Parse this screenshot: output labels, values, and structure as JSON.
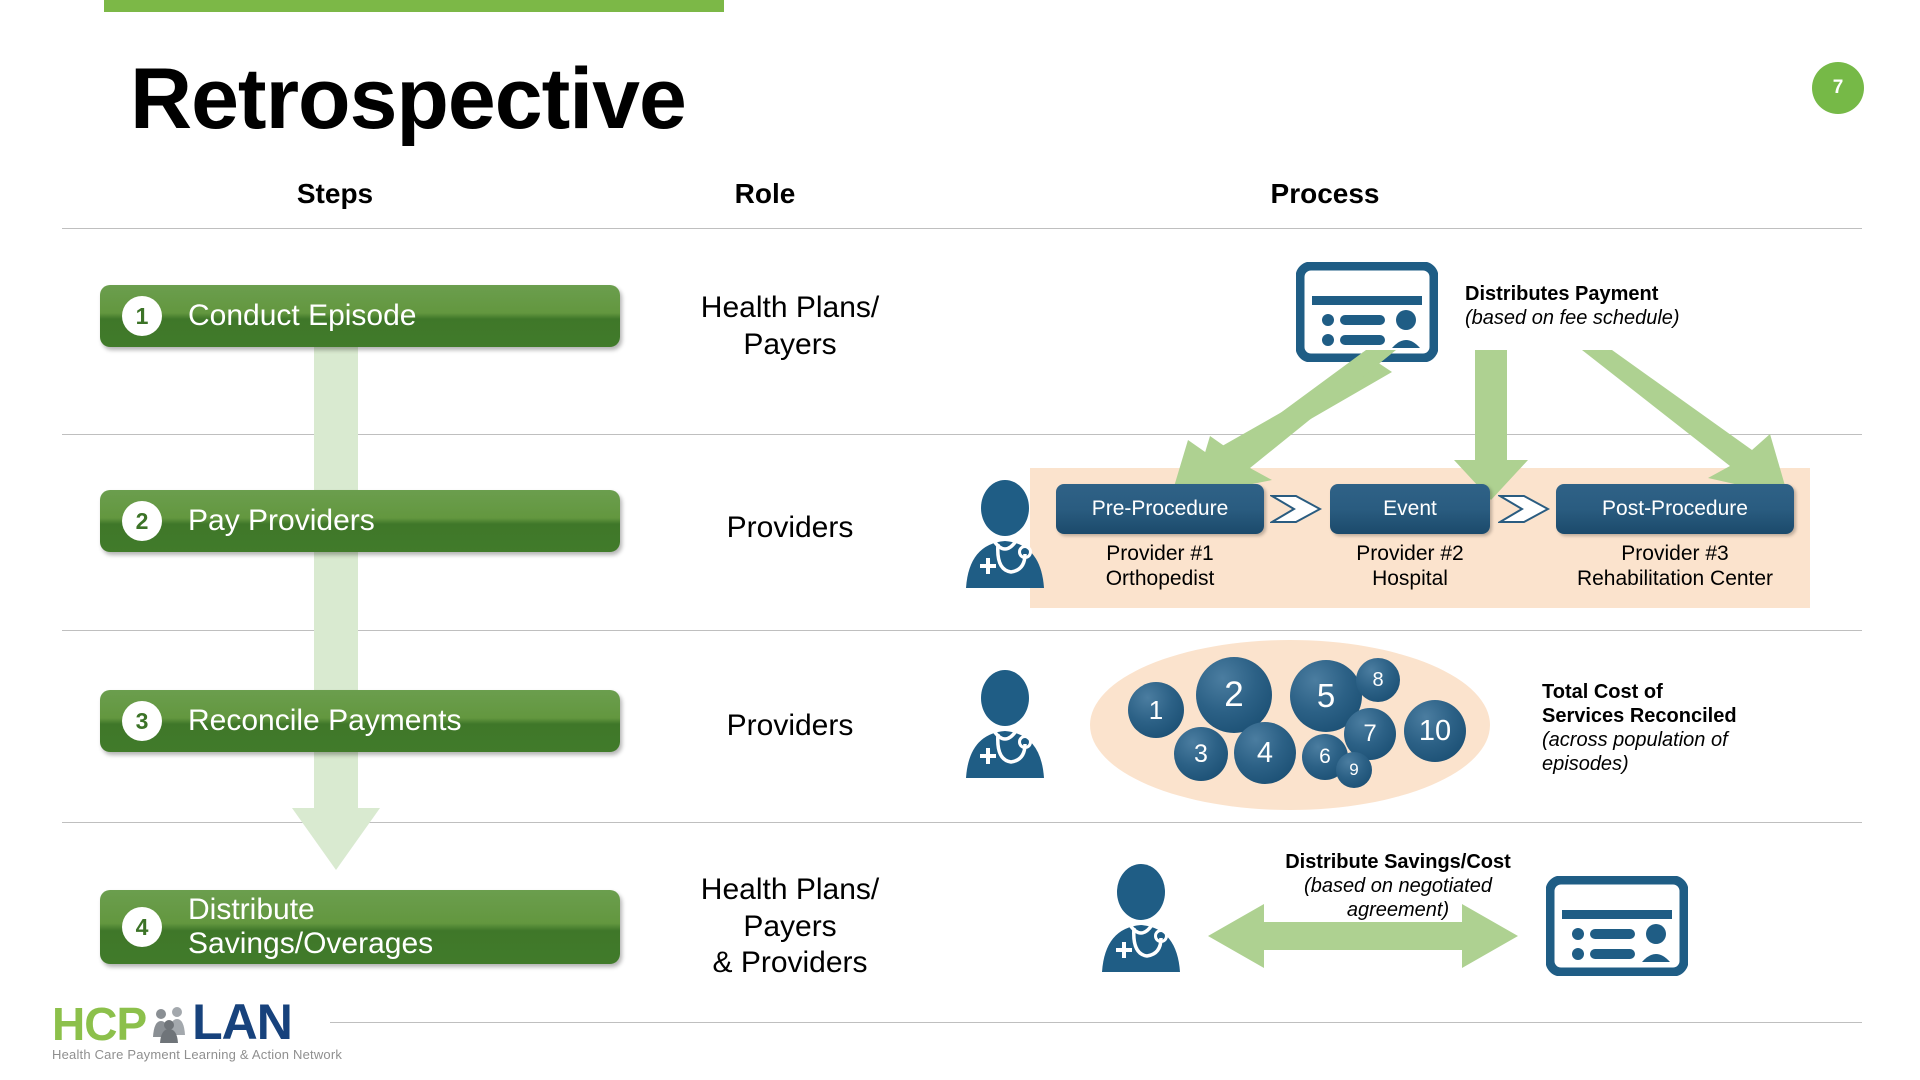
{
  "slide": {
    "title": "Retrospective",
    "page_number": "7",
    "accent_green": "#7cb847",
    "step_green": "#3f7729",
    "process_blue": "#1b4a6b",
    "band_peach": "#fbe3cd",
    "arrow_green_light": "#d9ead0",
    "arrow_green_mid": "#aed191"
  },
  "columns": {
    "steps": "Steps",
    "role": "Role",
    "process": "Process"
  },
  "rows": [
    {
      "step_number": "1",
      "step_label": "Conduct Episode",
      "role": "Health Plans/\nPayers",
      "process_title": "Distributes Payment",
      "process_sub": "(based on fee schedule)"
    },
    {
      "step_number": "2",
      "step_label": "Pay Providers",
      "role": "Providers",
      "process_title": "",
      "process_sub": ""
    },
    {
      "step_number": "3",
      "step_label": "Reconcile Payments",
      "role": "Providers",
      "process_title": "Total Cost of\nServices Reconciled",
      "process_sub": "(across population of\nepisodes)"
    },
    {
      "step_number": "4",
      "step_label": "Distribute\nSavings/Overages",
      "role": "Health Plans/\nPayers\n& Providers",
      "process_title": "Distribute Savings/Cost",
      "process_sub": "(based on negotiated\nagreement)"
    }
  ],
  "procedure_stages": [
    {
      "box_label": "Pre-Procedure",
      "caption": "Provider #1\nOrthopedist"
    },
    {
      "box_label": "Event",
      "caption": "Provider #2\nHospital"
    },
    {
      "box_label": "Post-Procedure",
      "caption": "Provider #3\nRehabilitation Center"
    }
  ],
  "episode_bubbles": [
    {
      "label": "1",
      "size": 56
    },
    {
      "label": "2",
      "size": 76
    },
    {
      "label": "3",
      "size": 54
    },
    {
      "label": "4",
      "size": 62
    },
    {
      "label": "5",
      "size": 72
    },
    {
      "label": "6",
      "size": 46
    },
    {
      "label": "7",
      "size": 52
    },
    {
      "label": "8",
      "size": 44
    },
    {
      "label": "9",
      "size": 36
    },
    {
      "label": "10",
      "size": 62
    }
  ],
  "logo": {
    "hcp": "HCP",
    "lan": "LAN",
    "tagline": "Health Care Payment Learning & Action Network"
  },
  "icons": {
    "payer_card": "insurance-card-icon",
    "provider": "doctor-icon",
    "stage_connector": "chevron-right-icon",
    "distribution": "double-arrow-icon"
  }
}
